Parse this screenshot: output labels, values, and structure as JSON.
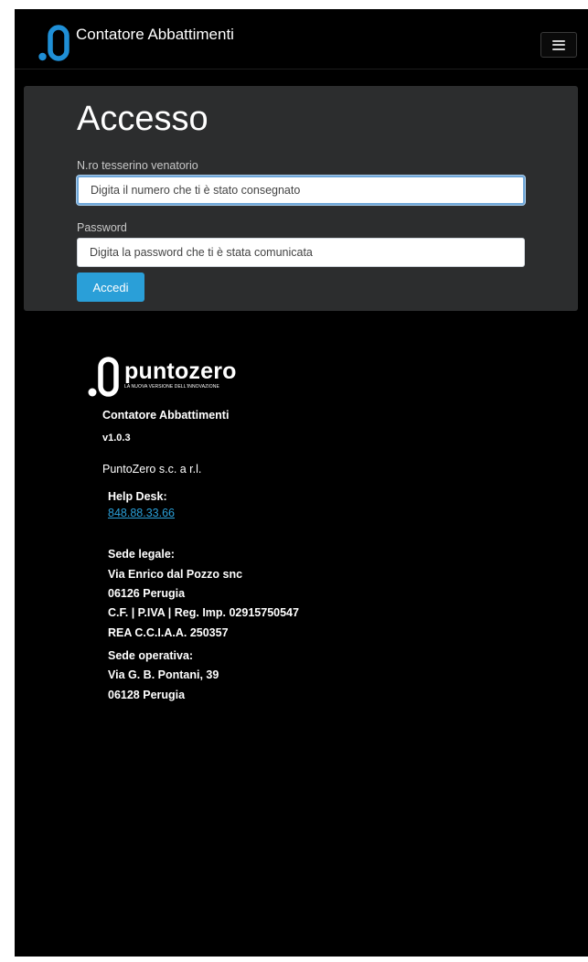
{
  "navbar": {
    "brand_title": "Contatore Abbattimenti",
    "logo_icon": "puntozero-logo-icon",
    "menu_icon": "hamburger-menu-icon"
  },
  "login": {
    "title": "Accesso",
    "card_number_label": "N.ro tesserino venatorio",
    "card_number_value": "",
    "card_number_placeholder": "Digita il numero che ti è stato consegnato",
    "password_label": "Password",
    "password_value": "",
    "password_placeholder": "Digita la password che ti è stata comunicata",
    "submit_label": "Accedi"
  },
  "footer": {
    "logo_name": "puntozero",
    "logo_tagline": "LA NUOVA VERSIONE DELL'INNOVAZIONE",
    "app_name": "Contatore Abbattimenti",
    "version": "v1.0.3",
    "company": "PuntoZero s.c. a r.l.",
    "helpdesk_label": "Help Desk:",
    "helpdesk_phone": "848.88.33.66",
    "legal_label": "Sede legale:",
    "legal_address": "Via Enrico dal Pozzo snc",
    "legal_city": "06126 Perugia",
    "legal_tax": "C.F. | P.IVA | Reg. Imp. 02915750547",
    "legal_rea": "REA C.C.I.A.A. 250357",
    "operative_label": "Sede operativa:",
    "operative_address": "Via G. B. Pontani, 39",
    "operative_city": "06128 Perugia"
  },
  "colors": {
    "background": "#000000",
    "panel": "#2c2d2e",
    "accent": "#2a9fd8",
    "logo_blue": "#1f8fd6",
    "text": "#ffffff"
  }
}
